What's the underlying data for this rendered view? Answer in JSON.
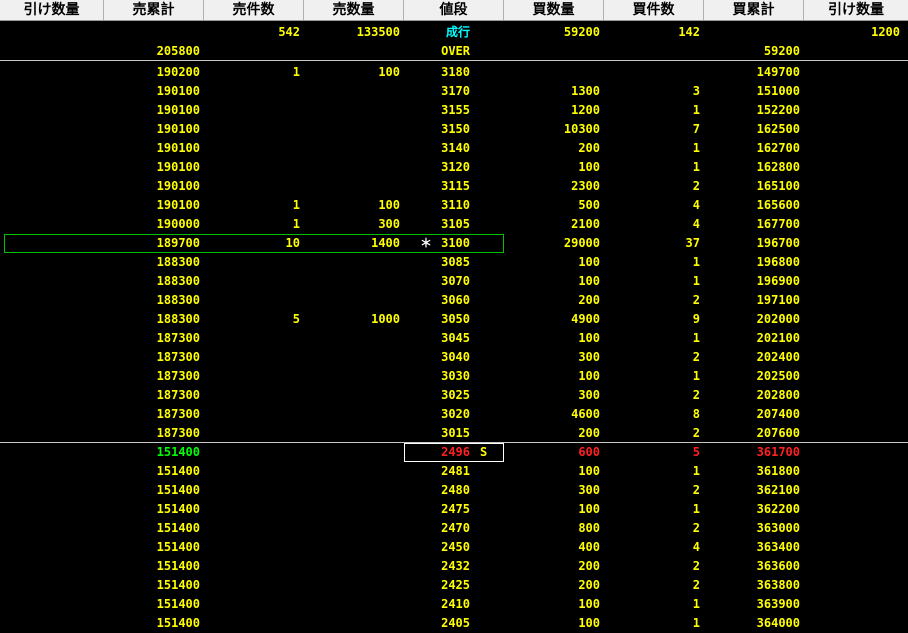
{
  "columns": [
    "引け数量",
    "売累計",
    "売件数",
    "売数量",
    "値段",
    "買数量",
    "買件数",
    "買累計",
    "引け数量"
  ],
  "market_order": {
    "sell_cases": "542",
    "sell_qty": "133500",
    "price": "成行",
    "buy_qty": "59200",
    "buy_cases": "142",
    "buy_close": "1200"
  },
  "over": {
    "sell_cum": "205800",
    "price": "OVER",
    "buy_cum": "59200"
  },
  "rows": [
    {
      "sell_cum": "190200",
      "sell_cases": "1",
      "sell_qty": "100",
      "price": "3180",
      "buy_qty": "",
      "buy_cases": "",
      "buy_cum": "149700"
    },
    {
      "sell_cum": "190100",
      "sell_cases": "",
      "sell_qty": "",
      "price": "3170",
      "buy_qty": "1300",
      "buy_cases": "3",
      "buy_cum": "151000"
    },
    {
      "sell_cum": "190100",
      "sell_cases": "",
      "sell_qty": "",
      "price": "3155",
      "buy_qty": "1200",
      "buy_cases": "1",
      "buy_cum": "152200"
    },
    {
      "sell_cum": "190100",
      "sell_cases": "",
      "sell_qty": "",
      "price": "3150",
      "buy_qty": "10300",
      "buy_cases": "7",
      "buy_cum": "162500"
    },
    {
      "sell_cum": "190100",
      "sell_cases": "",
      "sell_qty": "",
      "price": "3140",
      "buy_qty": "200",
      "buy_cases": "1",
      "buy_cum": "162700"
    },
    {
      "sell_cum": "190100",
      "sell_cases": "",
      "sell_qty": "",
      "price": "3120",
      "buy_qty": "100",
      "buy_cases": "1",
      "buy_cum": "162800"
    },
    {
      "sell_cum": "190100",
      "sell_cases": "",
      "sell_qty": "",
      "price": "3115",
      "buy_qty": "2300",
      "buy_cases": "2",
      "buy_cum": "165100"
    },
    {
      "sell_cum": "190100",
      "sell_cases": "1",
      "sell_qty": "100",
      "price": "3110",
      "buy_qty": "500",
      "buy_cases": "4",
      "buy_cum": "165600"
    },
    {
      "sell_cum": "190000",
      "sell_cases": "1",
      "sell_qty": "300",
      "price": "3105",
      "buy_qty": "2100",
      "buy_cases": "4",
      "buy_cum": "167700"
    },
    {
      "sell_cum": "189700",
      "sell_cases": "10",
      "sell_qty": "1400",
      "price": "3100",
      "buy_qty": "29000",
      "buy_cases": "37",
      "buy_cum": "196700",
      "marker": "＊"
    },
    {
      "sell_cum": "188300",
      "sell_cases": "",
      "sell_qty": "",
      "price": "3085",
      "buy_qty": "100",
      "buy_cases": "1",
      "buy_cum": "196800"
    },
    {
      "sell_cum": "188300",
      "sell_cases": "",
      "sell_qty": "",
      "price": "3070",
      "buy_qty": "100",
      "buy_cases": "1",
      "buy_cum": "196900"
    },
    {
      "sell_cum": "188300",
      "sell_cases": "",
      "sell_qty": "",
      "price": "3060",
      "buy_qty": "200",
      "buy_cases": "2",
      "buy_cum": "197100"
    },
    {
      "sell_cum": "188300",
      "sell_cases": "5",
      "sell_qty": "1000",
      "price": "3050",
      "buy_qty": "4900",
      "buy_cases": "9",
      "buy_cum": "202000"
    },
    {
      "sell_cum": "187300",
      "sell_cases": "",
      "sell_qty": "",
      "price": "3045",
      "buy_qty": "100",
      "buy_cases": "1",
      "buy_cum": "202100"
    },
    {
      "sell_cum": "187300",
      "sell_cases": "",
      "sell_qty": "",
      "price": "3040",
      "buy_qty": "300",
      "buy_cases": "2",
      "buy_cum": "202400"
    },
    {
      "sell_cum": "187300",
      "sell_cases": "",
      "sell_qty": "",
      "price": "3030",
      "buy_qty": "100",
      "buy_cases": "1",
      "buy_cum": "202500"
    },
    {
      "sell_cum": "187300",
      "sell_cases": "",
      "sell_qty": "",
      "price": "3025",
      "buy_qty": "300",
      "buy_cases": "2",
      "buy_cum": "202800"
    },
    {
      "sell_cum": "187300",
      "sell_cases": "",
      "sell_qty": "",
      "price": "3020",
      "buy_qty": "4600",
      "buy_cases": "8",
      "buy_cum": "207400"
    },
    {
      "sell_cum": "187300",
      "sell_cases": "",
      "sell_qty": "",
      "price": "3015",
      "buy_qty": "200",
      "buy_cases": "2",
      "buy_cum": "207600"
    },
    {
      "sell_cum": "151400",
      "sell_cases": "",
      "sell_qty": "",
      "price": "2496",
      "buy_qty": "600",
      "buy_cases": "5",
      "buy_cum": "361700",
      "marker": "S",
      "highlight": true
    },
    {
      "sell_cum": "151400",
      "sell_cases": "",
      "sell_qty": "",
      "price": "2481",
      "buy_qty": "100",
      "buy_cases": "1",
      "buy_cum": "361800"
    },
    {
      "sell_cum": "151400",
      "sell_cases": "",
      "sell_qty": "",
      "price": "2480",
      "buy_qty": "300",
      "buy_cases": "2",
      "buy_cum": "362100"
    },
    {
      "sell_cum": "151400",
      "sell_cases": "",
      "sell_qty": "",
      "price": "2475",
      "buy_qty": "100",
      "buy_cases": "1",
      "buy_cum": "362200"
    },
    {
      "sell_cum": "151400",
      "sell_cases": "",
      "sell_qty": "",
      "price": "2470",
      "buy_qty": "800",
      "buy_cases": "2",
      "buy_cum": "363000"
    },
    {
      "sell_cum": "151400",
      "sell_cases": "",
      "sell_qty": "",
      "price": "2450",
      "buy_qty": "400",
      "buy_cases": "4",
      "buy_cum": "363400"
    },
    {
      "sell_cum": "151400",
      "sell_cases": "",
      "sell_qty": "",
      "price": "2432",
      "buy_qty": "200",
      "buy_cases": "2",
      "buy_cum": "363600"
    },
    {
      "sell_cum": "151400",
      "sell_cases": "",
      "sell_qty": "",
      "price": "2425",
      "buy_qty": "200",
      "buy_cases": "2",
      "buy_cum": "363800"
    },
    {
      "sell_cum": "151400",
      "sell_cases": "",
      "sell_qty": "",
      "price": "2410",
      "buy_qty": "100",
      "buy_cases": "1",
      "buy_cum": "363900"
    },
    {
      "sell_cum": "151400",
      "sell_cases": "",
      "sell_qty": "",
      "price": "2405",
      "buy_qty": "100",
      "buy_cases": "1",
      "buy_cum": "364000"
    }
  ],
  "colors": {
    "text": "#ffff00",
    "market_price": "#00ffff",
    "highlight_sell_cum": "#00ff00",
    "highlight_buy": "#ff2020",
    "background": "#000000"
  }
}
